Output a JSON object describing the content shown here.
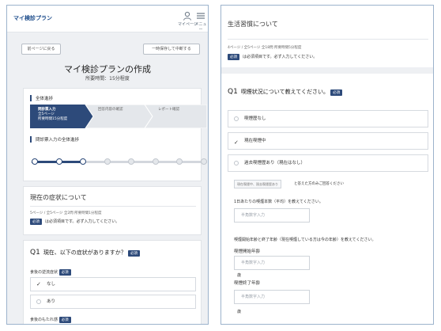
{
  "left": {
    "brand": "マイ検診プラン",
    "header_icons": {
      "mypage_label": "マイページ",
      "menu_label": "メニュー"
    },
    "prev_button": "前ページに戻る",
    "save_button": "一時保存して中断する",
    "page_title": "マイ検診プランの作成",
    "page_subtitle": "所要時間：15分程度",
    "overall": {
      "label": "全体進捗",
      "steps": [
        {
          "title": "問診票入力",
          "sub": "全5ページ\n所要時間15分程度"
        },
        {
          "title": "回答内容の確認",
          "sub": ""
        },
        {
          "title": "レポート確認",
          "sub": ""
        }
      ]
    },
    "question_progress_label": "問診票入力の全体進捗",
    "progress": {
      "completed": 3,
      "total": 8
    },
    "section": {
      "heading": "現在の症状について",
      "meta": "5ページ / 全5ページ  全2問 所要時間1分程度",
      "required_badge": "必須",
      "required_note": "は必須項目です。必ず入力してください。"
    },
    "question": {
      "number": "Q1",
      "text": "現在、以下の症状がありますか？",
      "badge": "必須",
      "sub1_label": "食後の逆流症状",
      "sub1_badge": "必須",
      "options": [
        {
          "label": "なし",
          "selected": true
        },
        {
          "label": "あり",
          "selected": false
        }
      ],
      "sub2_label": "食後のもたれ感",
      "sub2_badge": "必須"
    }
  },
  "right": {
    "heading": "生活習慣について",
    "meta": "4ページ / 全5ページ  全18問 所要時間5分程度",
    "required_badge": "必須",
    "required_note": "は必須項目です。必ず入力してください。",
    "question": {
      "number": "Q1",
      "text": "喫煙状況について教えてください。",
      "badge": "必須",
      "options": [
        {
          "label": "喫煙歴なし",
          "selected": false
        },
        {
          "label": "現在喫煙中",
          "selected": true
        },
        {
          "label": "過去喫煙歴あり（現在はなし）",
          "selected": false
        }
      ],
      "conditional_button": "現在喫煙中、過去喫煙歴あり",
      "conditional_note": "と答えた方のみご回答ください",
      "daily_label": "1日あたりの喫煙本数（平均）を教えてください。",
      "daily_placeholder": "半角数字入力",
      "age_label": "喫煙開始年齢と終了年齢（現在喫煙している方は今の年齢）を教えてください。",
      "start_age_label": "喫煙開始年齢",
      "start_age_placeholder": "半角数字入力",
      "start_unit": "歳",
      "end_age_label": "喫煙終了年齢",
      "end_age_placeholder": "半角数字入力",
      "end_unit": "歳"
    }
  },
  "colors": {
    "accent": "#2d4a7a",
    "background": "#eef0f3",
    "border": "#9cb3cc"
  }
}
